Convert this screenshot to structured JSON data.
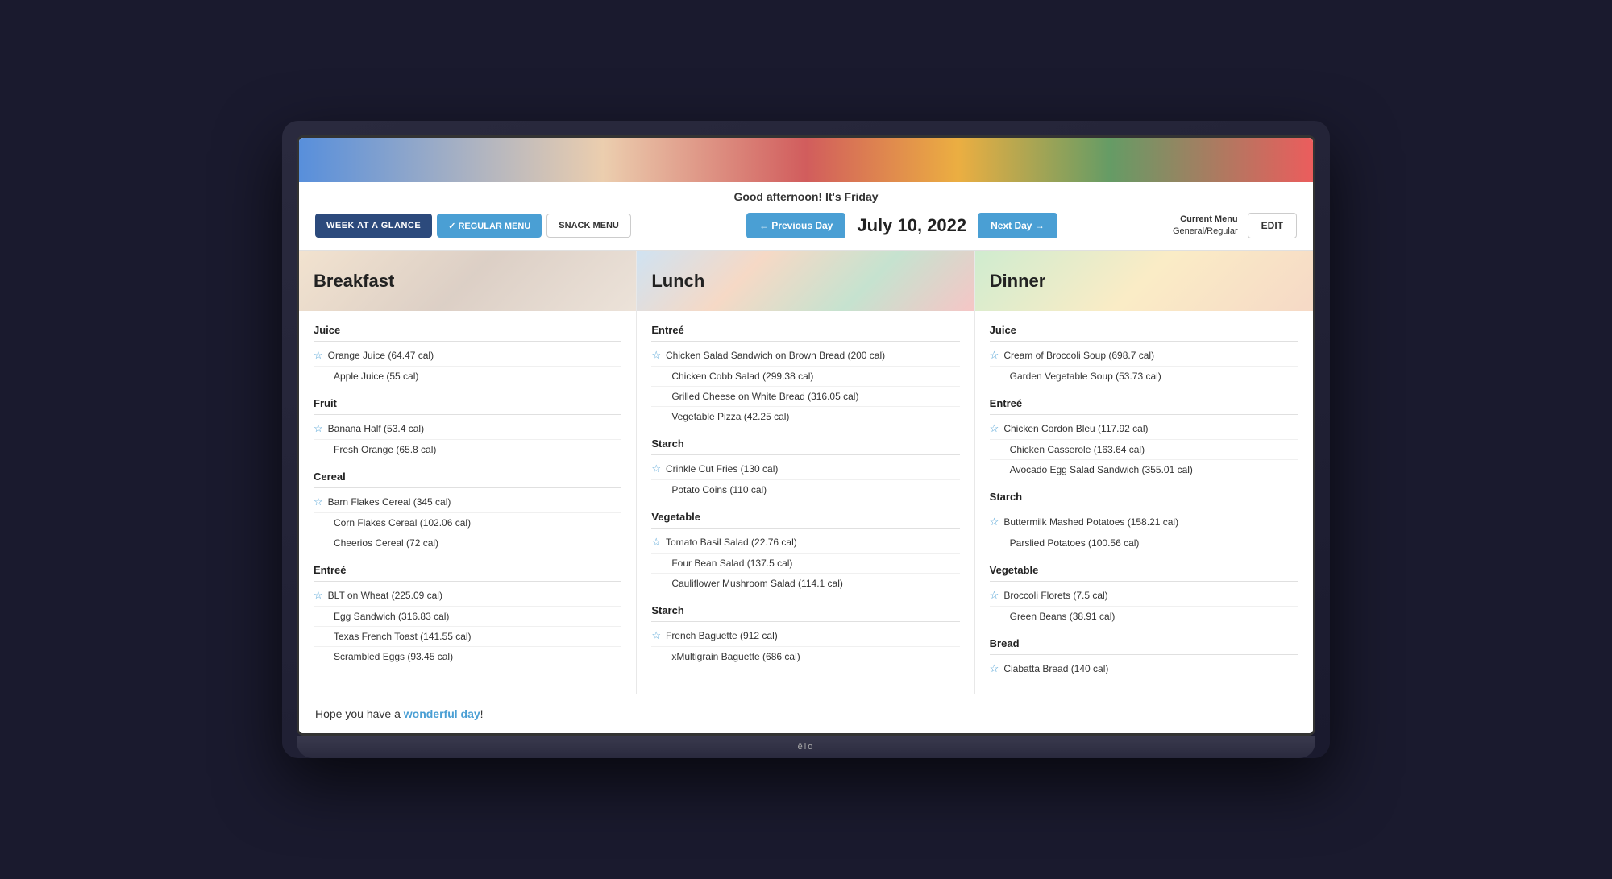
{
  "greeting": "Good afternoon! It's Friday",
  "date": "July 10, 2022",
  "buttons": {
    "week_at_glance": "WEEK AT A GLANCE",
    "regular_menu": "✓ REGULAR MENU",
    "snack_menu": "SNACK MENU",
    "prev_day": "← Previous Day",
    "next_day": "Next Day →",
    "edit": "EDIT"
  },
  "current_menu": {
    "label": "Current Menu",
    "value": "General/Regular"
  },
  "footer": {
    "prefix": "Hope you have a ",
    "highlight": "wonderful day",
    "suffix": "!"
  },
  "columns": [
    {
      "title": "Breakfast",
      "categories": [
        {
          "name": "Juice",
          "items": [
            {
              "text": "Orange Juice (64.47 cal)",
              "featured": true
            },
            {
              "text": "Apple Juice (55 cal)",
              "featured": false
            }
          ]
        },
        {
          "name": "Fruit",
          "items": [
            {
              "text": "Banana Half (53.4 cal)",
              "featured": true
            },
            {
              "text": "Fresh Orange (65.8 cal)",
              "featured": false
            }
          ]
        },
        {
          "name": "Cereal",
          "items": [
            {
              "text": "Barn Flakes Cereal (345 cal)",
              "featured": true
            },
            {
              "text": "Corn Flakes Cereal (102.06 cal)",
              "featured": false
            },
            {
              "text": "Cheerios Cereal (72 cal)",
              "featured": false
            }
          ]
        },
        {
          "name": "Entreé",
          "items": [
            {
              "text": "BLT on Wheat (225.09 cal)",
              "featured": true
            },
            {
              "text": "Egg Sandwich (316.83 cal)",
              "featured": false
            },
            {
              "text": "Texas French Toast (141.55 cal)",
              "featured": false
            },
            {
              "text": "Scrambled Eggs (93.45 cal)",
              "featured": false
            }
          ]
        }
      ]
    },
    {
      "title": "Lunch",
      "categories": [
        {
          "name": "Entreé",
          "items": [
            {
              "text": "Chicken Salad Sandwich on Brown Bread (200 cal)",
              "featured": true
            },
            {
              "text": "Chicken Cobb Salad (299.38 cal)",
              "featured": false
            },
            {
              "text": "Grilled Cheese on White Bread (316.05 cal)",
              "featured": false
            },
            {
              "text": "Vegetable Pizza (42.25 cal)",
              "featured": false
            }
          ]
        },
        {
          "name": "Starch",
          "items": [
            {
              "text": "Crinkle Cut Fries (130 cal)",
              "featured": true
            },
            {
              "text": "Potato Coins (110 cal)",
              "featured": false
            }
          ]
        },
        {
          "name": "Vegetable",
          "items": [
            {
              "text": "Tomato Basil Salad (22.76 cal)",
              "featured": true
            },
            {
              "text": "Four Bean Salad (137.5 cal)",
              "featured": false
            },
            {
              "text": "Cauliflower Mushroom Salad (114.1 cal)",
              "featured": false
            }
          ]
        },
        {
          "name": "Starch",
          "items": [
            {
              "text": "French Baguette (912 cal)",
              "featured": true
            },
            {
              "text": "xMultigrain Baguette (686 cal)",
              "featured": false
            }
          ]
        }
      ]
    },
    {
      "title": "Dinner",
      "categories": [
        {
          "name": "Juice",
          "items": [
            {
              "text": "Cream of Broccoli Soup (698.7 cal)",
              "featured": true
            },
            {
              "text": "Garden Vegetable Soup (53.73 cal)",
              "featured": false
            }
          ]
        },
        {
          "name": "Entreé",
          "items": [
            {
              "text": "Chicken Cordon Bleu (117.92 cal)",
              "featured": true
            },
            {
              "text": "Chicken Casserole (163.64 cal)",
              "featured": false
            },
            {
              "text": "Avocado Egg Salad Sandwich (355.01 cal)",
              "featured": false
            }
          ]
        },
        {
          "name": "Starch",
          "items": [
            {
              "text": "Buttermilk Mashed Potatoes (158.21 cal)",
              "featured": true
            },
            {
              "text": "Parslied Potatoes (100.56 cal)",
              "featured": false
            }
          ]
        },
        {
          "name": "Vegetable",
          "items": [
            {
              "text": "Broccoli Florets (7.5 cal)",
              "featured": true
            },
            {
              "text": "Green Beans (38.91 cal)",
              "featured": false
            }
          ]
        },
        {
          "name": "Bread",
          "items": [
            {
              "text": "Ciabatta Bread (140 cal)",
              "featured": true
            }
          ]
        }
      ]
    }
  ]
}
